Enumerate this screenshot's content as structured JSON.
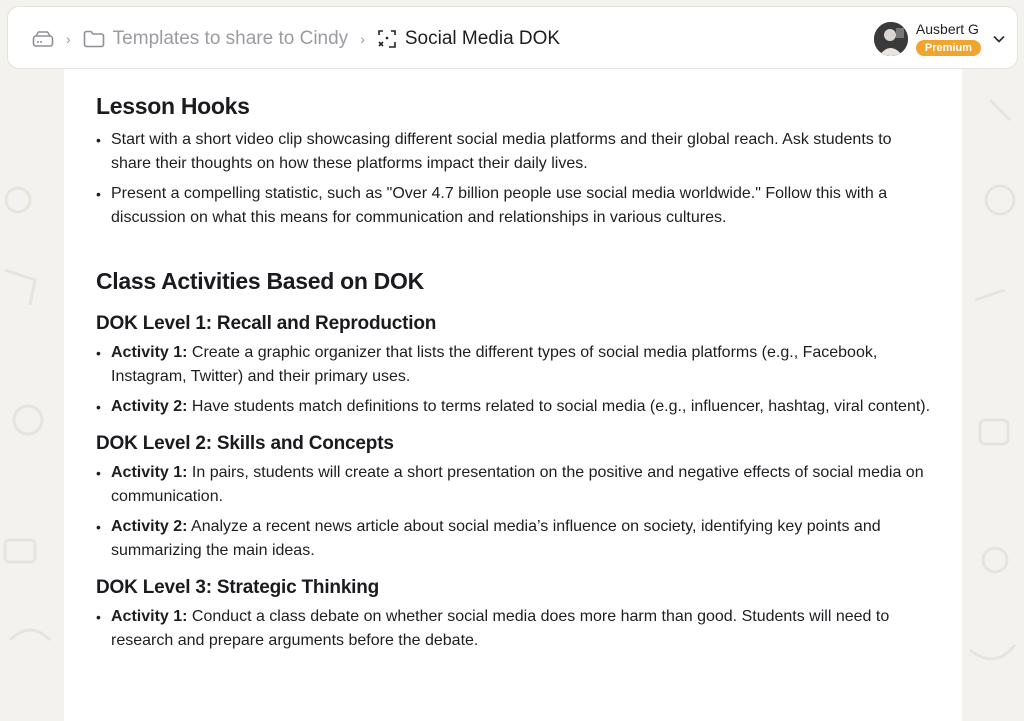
{
  "breadcrumb": {
    "folder_label": "Templates to share to Cindy",
    "current_label": "Social Media DOK"
  },
  "user": {
    "name": "Ausbert G",
    "badge": "Premium"
  },
  "content": {
    "hooks_title": "Lesson Hooks",
    "hooks": [
      "Start with a short video clip showcasing different social media platforms and their global reach. Ask students to share their thoughts on how these platforms impact their daily lives.",
      "Present a compelling statistic, such as \"Over 4.7 billion people use social media worldwide.\" Follow this with a discussion on what this means for communication and relationships in various cultures."
    ],
    "activities_title": "Class Activities Based on DOK",
    "levels": [
      {
        "title": "DOK Level 1: Recall and Reproduction",
        "items": [
          {
            "label": "Activity 1:",
            "text": " Create a graphic organizer that lists the different types of social media platforms (e.g., Facebook, Instagram, Twitter) and their primary uses."
          },
          {
            "label": "Activity 2:",
            "text": " Have students match definitions to terms related to social media (e.g., influencer, hashtag, viral content)."
          }
        ]
      },
      {
        "title": "DOK Level 2: Skills and Concepts",
        "items": [
          {
            "label": "Activity 1:",
            "text": " In pairs, students will create a short presentation on the positive and negative effects of social media on communication."
          },
          {
            "label": "Activity 2:",
            "text": " Analyze a recent news article about social media’s influence on society, identifying key points and summarizing the main ideas."
          }
        ]
      },
      {
        "title": "DOK Level 3: Strategic Thinking",
        "items": [
          {
            "label": "Activity 1:",
            "text": " Conduct a class debate on whether social media does more harm than good. Students will need to research and prepare arguments before the debate."
          }
        ]
      }
    ]
  },
  "colors": {
    "background": "#f4f2ee",
    "badge": "#f0a531"
  }
}
